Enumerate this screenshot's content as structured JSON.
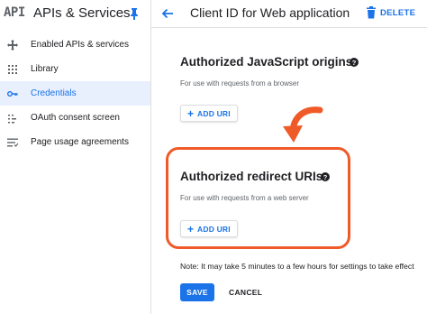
{
  "sidebar": {
    "logo": "API",
    "title": "APIs & Services",
    "pin_icon": "pin-icon",
    "items": [
      {
        "label": "Enabled APIs & services",
        "icon": "enabled-apis-icon",
        "active": false
      },
      {
        "label": "Library",
        "icon": "library-icon",
        "active": false
      },
      {
        "label": "Credentials",
        "icon": "key-icon",
        "active": true
      },
      {
        "label": "OAuth consent screen",
        "icon": "consent-screen-icon",
        "active": false
      },
      {
        "label": "Page usage agreements",
        "icon": "page-usage-icon",
        "active": false
      }
    ]
  },
  "topbar": {
    "title": "Client ID for Web application",
    "delete_label": "DELETE"
  },
  "sections": [
    {
      "title": "Authorized JavaScript origins",
      "description": "For use with requests from a browser",
      "add_label": "ADD URI"
    },
    {
      "title": "Authorized redirect URIs",
      "description": "For use with requests from a web server",
      "add_label": "ADD URI"
    }
  ],
  "note": "Note: It may take 5 minutes to a few hours for settings to take effect",
  "actions": {
    "save_label": "SAVE",
    "cancel_label": "CANCEL"
  },
  "colors": {
    "accent": "#1a73e8",
    "active_bg": "#e8f0fe",
    "highlight": "#f05a28"
  }
}
